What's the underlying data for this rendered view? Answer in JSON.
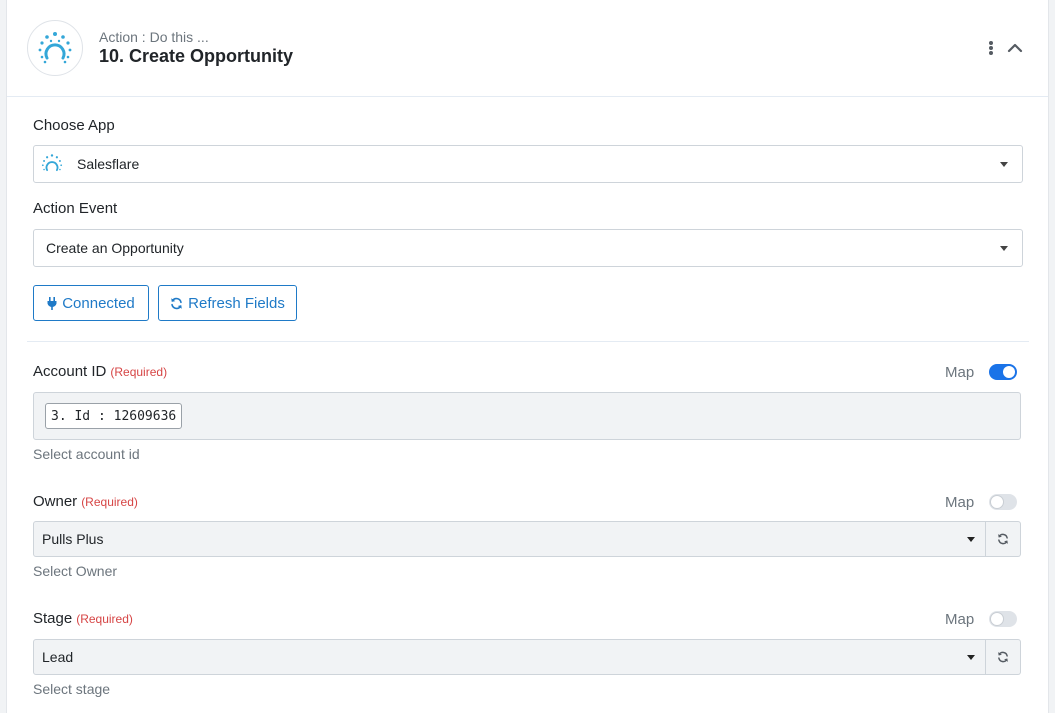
{
  "header": {
    "pre_title": "Action : Do this ...",
    "title": "10. Create Opportunity",
    "logo_icon": "salesflare-logo-icon",
    "accent": "#1f7ac7"
  },
  "choose_app": {
    "label": "Choose App",
    "value": "Salesflare"
  },
  "action_event": {
    "label": "Action Event",
    "value": "Create an Opportunity"
  },
  "buttons": {
    "connected": "Connected",
    "refresh_fields": "Refresh Fields"
  },
  "fields": {
    "account_id": {
      "label": "Account ID",
      "required": "(Required)",
      "map_label": "Map",
      "map_on": true,
      "chip": "3. Id : 12609636",
      "help": "Select account id"
    },
    "owner": {
      "label": "Owner",
      "required": "(Required)",
      "map_label": "Map",
      "map_on": false,
      "value": "Pulls Plus",
      "help": "Select Owner"
    },
    "stage": {
      "label": "Stage",
      "required": "(Required)",
      "map_label": "Map",
      "map_on": false,
      "value": "Lead",
      "help": "Select stage"
    }
  },
  "colors": {
    "required": "#d64545",
    "toggle_on": "#1a73e8",
    "field_bg": "#f1f3f5"
  }
}
